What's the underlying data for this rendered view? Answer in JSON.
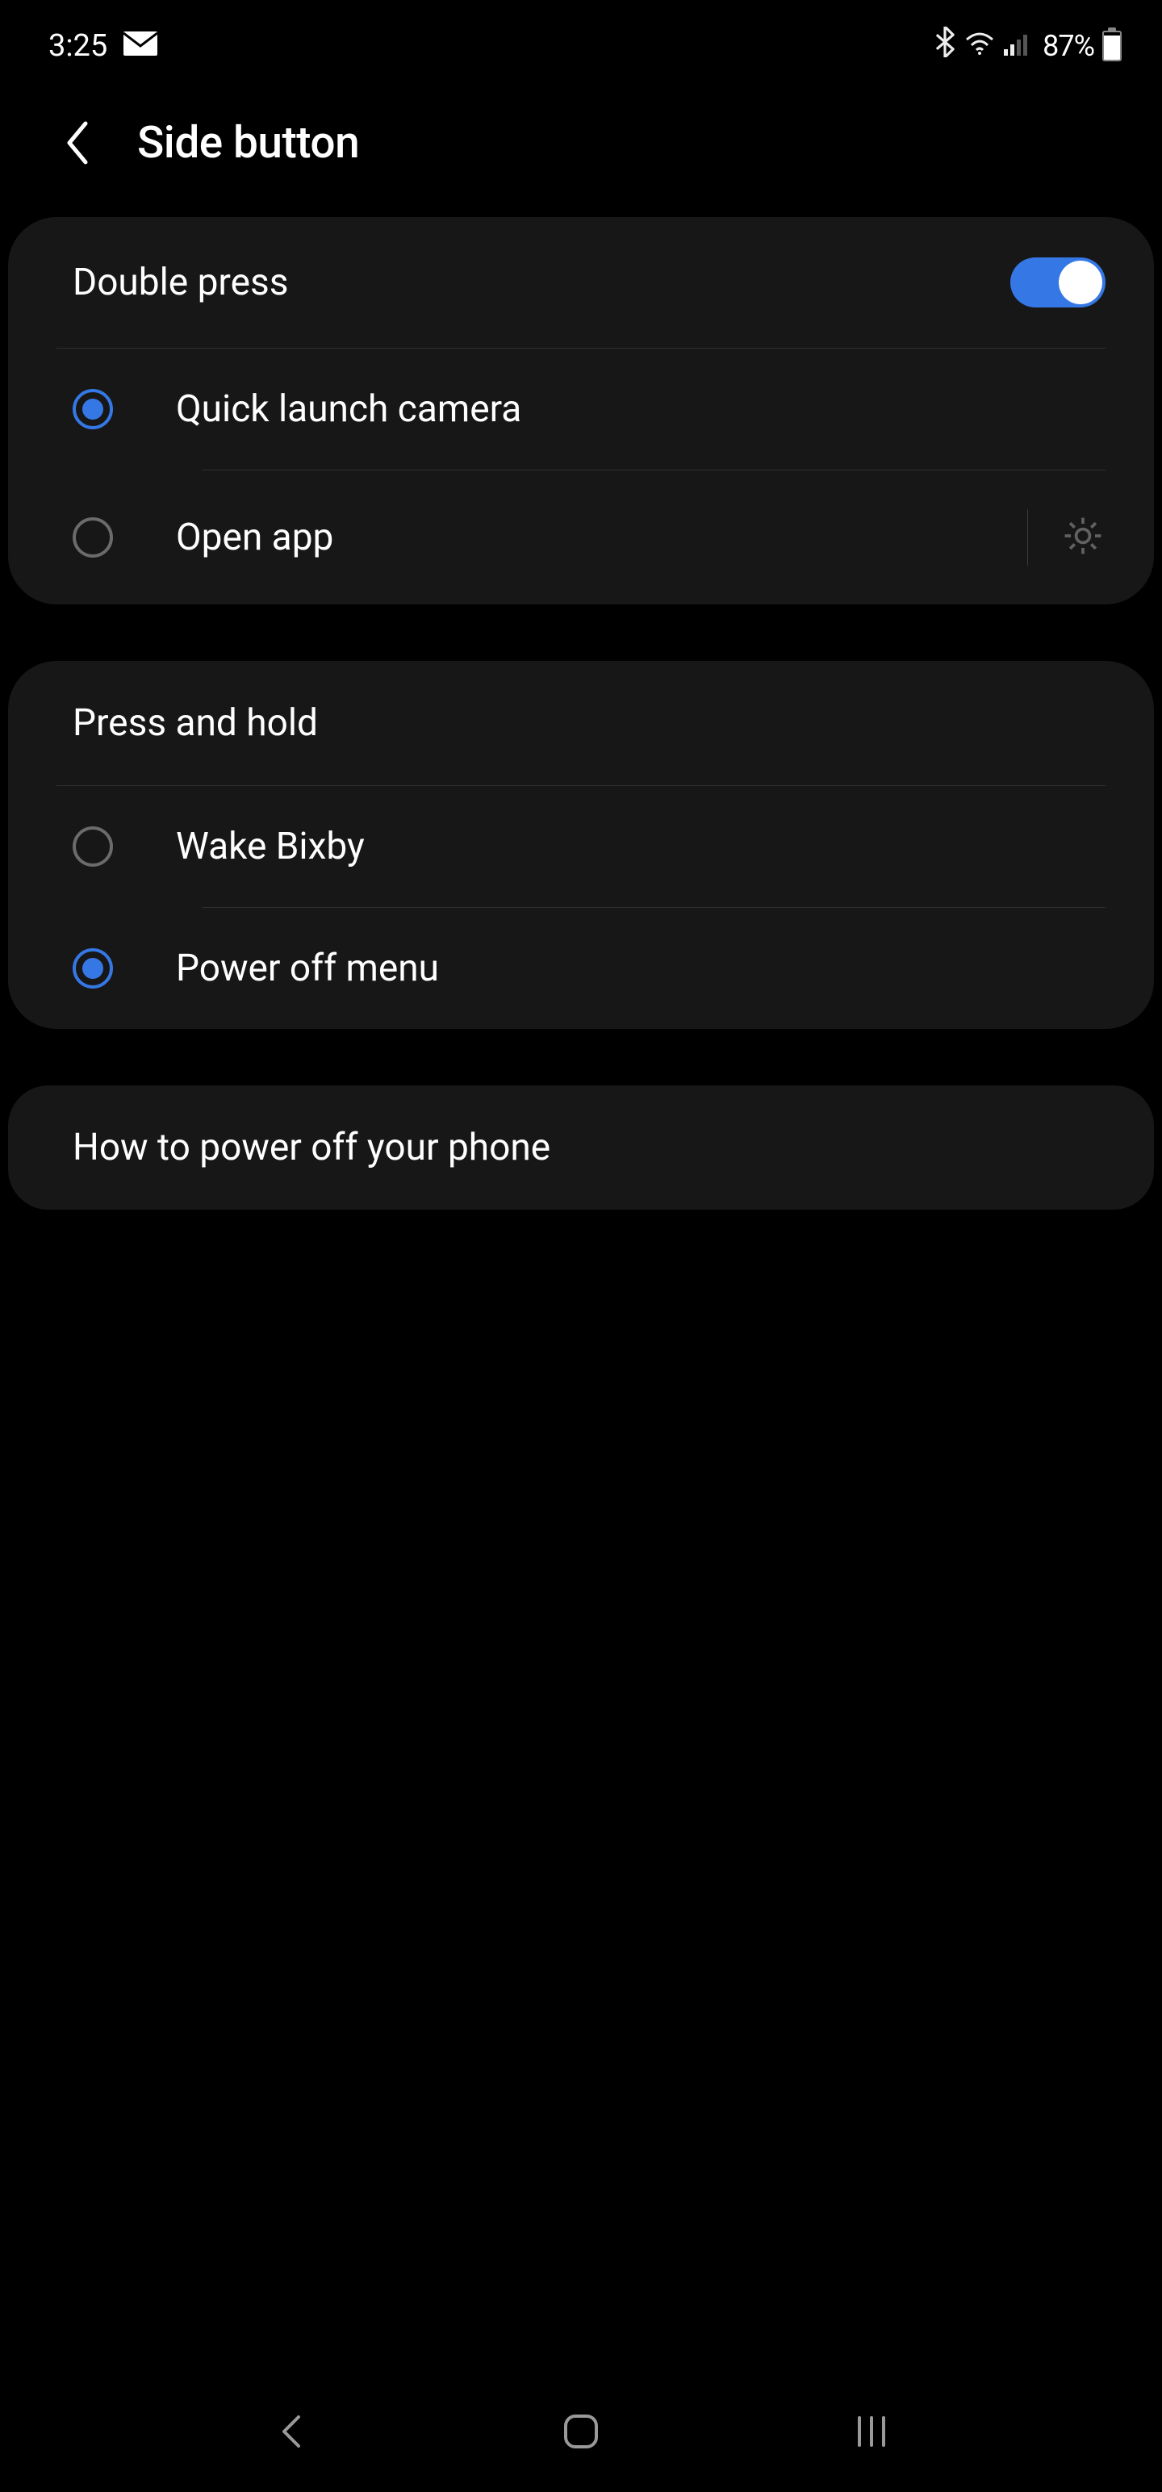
{
  "status": {
    "time": "3:25",
    "battery": "87%"
  },
  "header": {
    "title": "Side button"
  },
  "sections": {
    "double_press": {
      "title": "Double press",
      "toggle": true,
      "options": [
        {
          "label": "Quick launch camera",
          "selected": true
        },
        {
          "label": "Open app",
          "selected": false,
          "has_gear": true
        }
      ]
    },
    "press_hold": {
      "title": "Press and hold",
      "options": [
        {
          "label": "Wake Bixby",
          "selected": false
        },
        {
          "label": "Power off menu",
          "selected": true
        }
      ]
    }
  },
  "footer_item": {
    "label": "How to power off your phone"
  }
}
